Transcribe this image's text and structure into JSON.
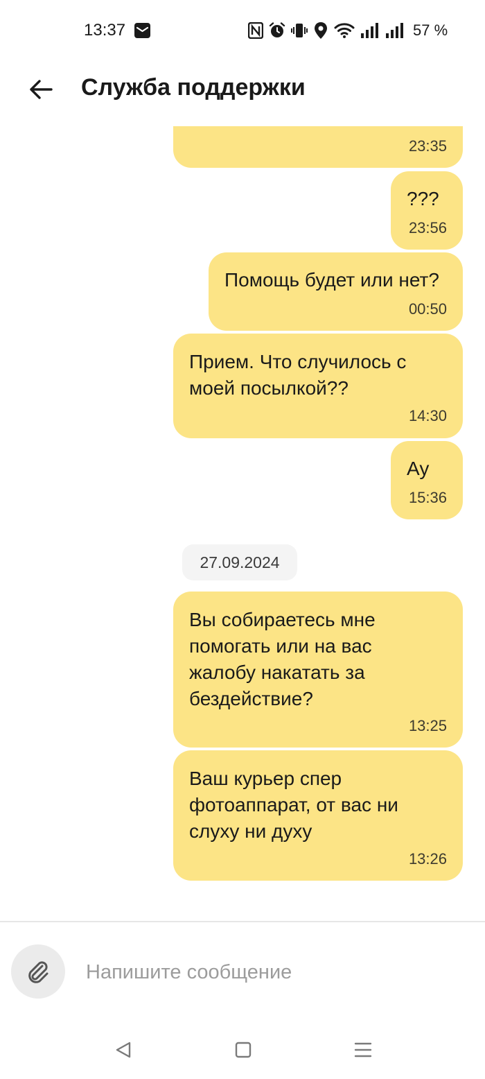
{
  "status_bar": {
    "time": "13:37",
    "battery": "57 %",
    "icons": [
      "mail-icon",
      "nfc-icon",
      "alarm-icon",
      "vibrate-icon",
      "location-icon",
      "wifi-icon",
      "signal-icon",
      "signal-icon"
    ]
  },
  "header": {
    "title": "Служба поддержки",
    "back_icon": "arrow-left-icon"
  },
  "messages": [
    {
      "text": "",
      "time": "23:35"
    },
    {
      "text": "???",
      "time": "23:56"
    },
    {
      "text": "Помощь будет или нет?",
      "time": "00:50"
    },
    {
      "text": "Прием. Что случилось с\nмоей посылкой??",
      "time": "14:30"
    },
    {
      "text": "Ау",
      "time": "15:36"
    },
    {
      "text": "Вы собираетесь мне\nпомогать или на вас\nжалобу накатать за\nбездействие?",
      "time": "13:25"
    },
    {
      "text": "Ваш курьер спер\nфотоаппарат, от вас ни\nслуху ни духу",
      "time": "13:26"
    }
  ],
  "date_separator": "27.09.2024",
  "composer": {
    "placeholder": "Напишите сообщение",
    "value": "",
    "attach_icon": "paperclip-icon"
  },
  "nav_bar": [
    "back-triangle-icon",
    "home-square-icon",
    "recents-menu-icon"
  ],
  "colors": {
    "bubble": "#fce486",
    "date_chip": "#f4f4f4",
    "attach_bg": "#ebebeb"
  }
}
